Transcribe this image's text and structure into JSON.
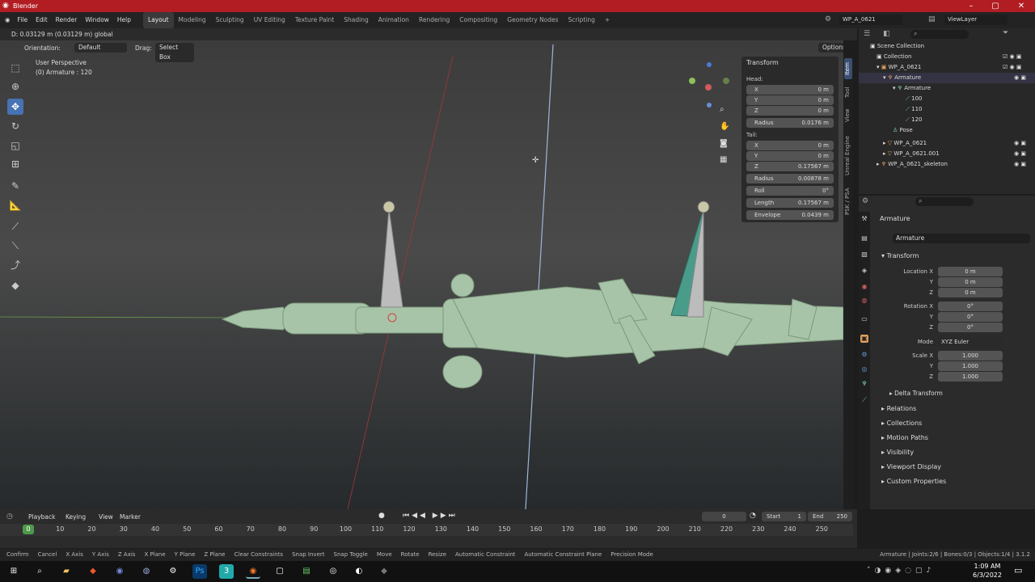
{
  "window": {
    "title": "Blender"
  },
  "menu": {
    "items": [
      "File",
      "Edit",
      "Render",
      "Window",
      "Help"
    ],
    "workspaces": [
      "Layout",
      "Modeling",
      "Sculpting",
      "UV Editing",
      "Texture Paint",
      "Shading",
      "Animation",
      "Rendering",
      "Compositing",
      "Geometry Nodes",
      "Scripting",
      "+"
    ],
    "scene": "WP_A_0621",
    "view_layer": "ViewLayer"
  },
  "header": {
    "status": "D: 0.03129 m (0.03129 m) global",
    "orientation_label": "Orientation:",
    "orientation_value": "Default",
    "drag_label": "Drag:",
    "drag_value": "Select Box",
    "options": "Options"
  },
  "viewport": {
    "perspective": "User Perspective",
    "object": "(0) Armature : 120"
  },
  "npanel": {
    "title": "Transform",
    "head_label": "Head:",
    "tail_label": "Tail:",
    "head": [
      {
        "k": "X",
        "v": "0 m"
      },
      {
        "k": "Y",
        "v": "0 m"
      },
      {
        "k": "Z",
        "v": "0 m"
      },
      {
        "k": "Radius",
        "v": "0.0176 m"
      }
    ],
    "tail": [
      {
        "k": "X",
        "v": "0 m"
      },
      {
        "k": "Y",
        "v": "0 m"
      },
      {
        "k": "Z",
        "v": "0.17567 m"
      },
      {
        "k": "Radius",
        "v": "0.00878 m"
      },
      {
        "k": "Roll",
        "v": "0°"
      },
      {
        "k": "Length",
        "v": "0.17567 m"
      },
      {
        "k": "Envelope",
        "v": "0.0439 m"
      }
    ],
    "tabs": [
      "Item",
      "Tool",
      "View",
      "Unreal Engine",
      "PSK / PSA"
    ]
  },
  "outliner": {
    "rows": [
      "Scene Collection",
      "Collection",
      "WP_A_0621",
      "Armature",
      "Armature",
      "100",
      "110",
      "120",
      "Pose",
      "WP_A_0621",
      "WP_A_0621.001",
      "WP_A_0621_skeleton"
    ]
  },
  "properties": {
    "breadcrumb": "Armature",
    "name": "Armature",
    "transform": "Transform",
    "location_label": "Location X",
    "location": [
      "0 m",
      "0 m",
      "0 m"
    ],
    "rotation_label": "Rotation X",
    "rotation": [
      "0°",
      "0°",
      "0°"
    ],
    "mode_label": "Mode",
    "mode_value": "XYZ Euler",
    "scale_label": "Scale X",
    "scale": [
      "1.000",
      "1.000",
      "1.000"
    ],
    "axis_y": "Y",
    "axis_z": "Z",
    "delta": "Delta Transform",
    "sections": [
      "Relations",
      "Collections",
      "Motion Paths",
      "Visibility",
      "Viewport Display",
      "Custom Properties"
    ]
  },
  "timeline": {
    "menus": [
      "Playback",
      "Keying",
      "View",
      "Marker"
    ],
    "current": "0",
    "start_label": "Start",
    "start": "1",
    "end_label": "End",
    "end": "250",
    "ticks": [
      "0",
      "10",
      "20",
      "30",
      "40",
      "50",
      "60",
      "70",
      "80",
      "90",
      "100",
      "110",
      "120",
      "130",
      "140",
      "150",
      "160",
      "170",
      "180",
      "190",
      "200",
      "210",
      "220",
      "230",
      "240",
      "250"
    ]
  },
  "statusbar": {
    "items": [
      "Confirm",
      "Cancel",
      "X Axis",
      "Y Axis",
      "Z Axis",
      "X Plane",
      "Y Plane",
      "Z Plane",
      "Clear Constraints",
      "Snap Invert",
      "Snap Toggle",
      "Move",
      "Rotate",
      "Resize",
      "Automatic Constraint",
      "Automatic Constraint Plane",
      "Precision Mode"
    ],
    "stats": "Armature | Joints:2/6 | Bones:0/3 | Objects:1/4 | 3.1.2"
  },
  "taskbar": {
    "time": "1:09 AM",
    "date": "6/3/2022"
  },
  "colors": {
    "title_bar": "#b11d22",
    "accent": "#4772b3",
    "mesh": "#a8c4a8"
  }
}
